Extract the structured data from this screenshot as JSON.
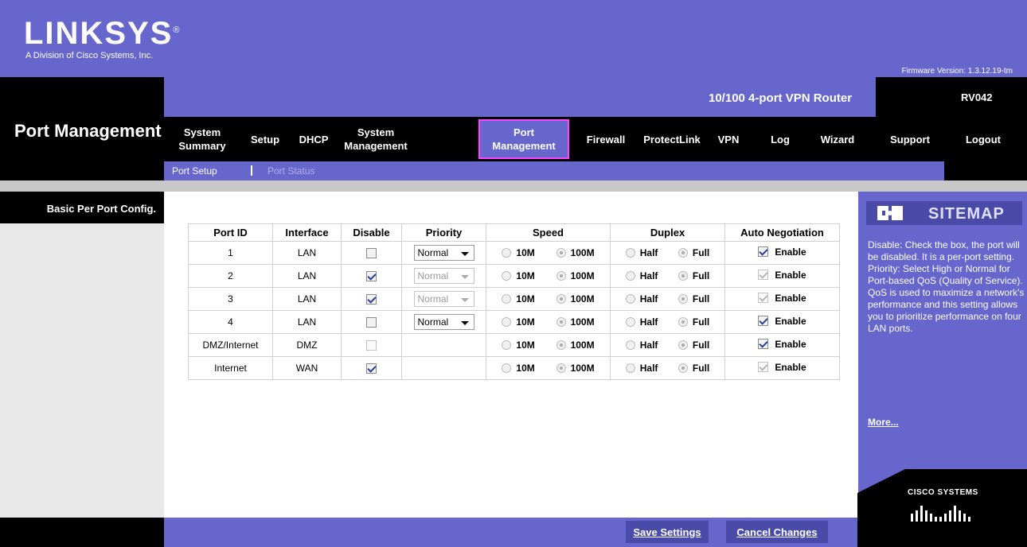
{
  "header": {
    "logo": "LINKSYS",
    "tagline": "A Division of Cisco Systems, Inc.",
    "firmware": "Firmware Version: 1.3.12.19-tm"
  },
  "product": {
    "name": "10/100 4-port VPN Router",
    "model": "RV042"
  },
  "page_title": "Port Management",
  "nav": {
    "items": [
      {
        "label": "System\nSummary"
      },
      {
        "label": "Setup"
      },
      {
        "label": "DHCP"
      },
      {
        "label": "System\nManagement"
      },
      {
        "label": "Port\nManagement"
      },
      {
        "label": "Firewall"
      },
      {
        "label": "ProtectLink"
      },
      {
        "label": "VPN"
      },
      {
        "label": "Log"
      },
      {
        "label": "Wizard"
      },
      {
        "label": "Support"
      },
      {
        "label": "Logout"
      }
    ],
    "active": "Port Management"
  },
  "subnav": {
    "items": [
      {
        "label": "Port Setup"
      },
      {
        "label": "Port Status"
      }
    ]
  },
  "section_label": "Basic Per Port Config.",
  "table": {
    "headers": [
      "Port ID",
      "Interface",
      "Disable",
      "Priority",
      "Speed",
      "Duplex",
      "Auto Negotiation"
    ],
    "speed_options": [
      "10M",
      "100M"
    ],
    "duplex_options": [
      "Half",
      "Full"
    ],
    "enable_label": "Enable",
    "rows": [
      {
        "port": "1",
        "iface": "LAN",
        "disable": false,
        "priority": "Normal",
        "priority_enabled": true,
        "speed": "100M",
        "duplex": "Full",
        "auto": true,
        "auto_enabled": true
      },
      {
        "port": "2",
        "iface": "LAN",
        "disable": true,
        "priority": "Normal",
        "priority_enabled": false,
        "speed": "100M",
        "duplex": "Full",
        "auto": true,
        "auto_enabled": false
      },
      {
        "port": "3",
        "iface": "LAN",
        "disable": true,
        "priority": "Normal",
        "priority_enabled": false,
        "speed": "100M",
        "duplex": "Full",
        "auto": true,
        "auto_enabled": false
      },
      {
        "port": "4",
        "iface": "LAN",
        "disable": false,
        "priority": "Normal",
        "priority_enabled": true,
        "speed": "100M",
        "duplex": "Full",
        "auto": true,
        "auto_enabled": true
      },
      {
        "port": "DMZ/Internet",
        "iface": "DMZ",
        "disable": false,
        "disable_enabled": false,
        "priority": "",
        "priority_enabled": false,
        "speed": "100M",
        "duplex": "Full",
        "auto": true,
        "auto_enabled": true
      },
      {
        "port": "Internet",
        "iface": "WAN",
        "disable": true,
        "priority": "",
        "priority_enabled": false,
        "speed": "100M",
        "duplex": "Full",
        "auto": true,
        "auto_enabled": false
      }
    ]
  },
  "sitemap": {
    "title": "SITEMAP",
    "help": "Disable: Check the box, the port will be disabled. It is a per-port setting. Priority: Select High or Normal for Port-based QoS (Quality of Service). QoS is used to maximize a network's performance and this setting allows you to prioritize performance on four LAN ports.",
    "more": "More...",
    "cisco": "CISCO SYSTEMS"
  },
  "footer": {
    "save": "Save Settings",
    "cancel": "Cancel Changes"
  },
  "colors": {
    "brand": "#6666cc",
    "active_border": "#ff44ff"
  }
}
